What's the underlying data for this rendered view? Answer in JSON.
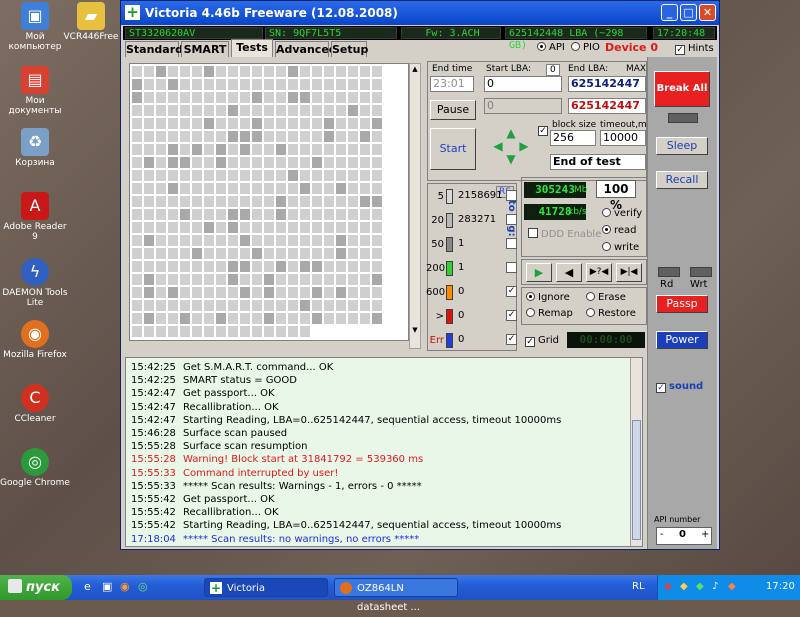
{
  "window": {
    "title": "Victoria 4.46b Freeware (12.08.2008)",
    "min": "_",
    "max": "□",
    "close": "✕"
  },
  "infobar": {
    "model": "ST3320620AV",
    "serial": "SN: 9QF7L5T5",
    "firmware": "Fw: 3.ACH",
    "lba": "625142448 LBA (~298 GB)",
    "time": "17:20:48"
  },
  "tabs": [
    "Standard",
    "SMART",
    "Tests",
    "Advanced",
    "Setup"
  ],
  "mode": {
    "api": "API",
    "pio": "PIO",
    "device": "Device 0",
    "hints": "Hints"
  },
  "controls": {
    "end_time_label": "End time",
    "end_time_value": "23:01",
    "start_lba_label": "Start LBA:",
    "start_lba_zero": "0",
    "start_lba_value": "0",
    "end_lba_label": "End LBA:",
    "end_lba_max": "MAX",
    "end_lba_value": "625142447",
    "end_lba_current": "625142447",
    "second_value": "0",
    "pause": "Pause",
    "start": "Start",
    "block_size_label": "block size",
    "block_size_value": "256",
    "timeout_label": "timeout,ms",
    "timeout_value": "10000",
    "end_action": "End of test"
  },
  "stats": {
    "rs": "RS",
    "to_log": "to log:",
    "rows": [
      {
        "label": "5",
        "value": "2158691",
        "color": "#d8d8d8"
      },
      {
        "label": "20",
        "value": "283271",
        "color": "#b8b8b8"
      },
      {
        "label": "50",
        "value": "1",
        "color": "#888888"
      },
      {
        "label": "200",
        "value": "1",
        "color": "#30d030"
      },
      {
        "label": "600",
        "value": "0",
        "color": "#ff8a00"
      },
      {
        "label": ">",
        "value": "0",
        "color": "#e01010"
      },
      {
        "label": "Err",
        "value": "0",
        "color": "#1f3fd8"
      }
    ]
  },
  "speed": {
    "mb": "305243",
    "mb_unit": "Mb",
    "percent": "100",
    "percent_unit": "%",
    "kbs": "41728",
    "kbs_unit": "kb/s",
    "ddd": "DDD Enable",
    "verify": "verify",
    "read": "read",
    "write": "write"
  },
  "actions": {
    "ignore": "Ignore",
    "erase": "Erase",
    "remap": "Remap",
    "restore": "Restore",
    "grid": "Grid",
    "timer": "00:00:00"
  },
  "right": {
    "break_all": "Break All",
    "sleep": "Sleep",
    "recall": "Recall",
    "rd": "Rd",
    "wrt": "Wrt",
    "passp": "Passp",
    "power": "Power",
    "sound": "sound",
    "api_number_label": "API number",
    "api_number_value": "0",
    "minus": "-",
    "plus": "+"
  },
  "log": [
    {
      "time": "15:42:25",
      "text": "Get S.M.A.R.T. command... OK",
      "color": "#000000"
    },
    {
      "time": "15:42:25",
      "text": "SMART status = GOOD",
      "color": "#000000"
    },
    {
      "time": "15:42:47",
      "text": "Get passport... OK",
      "color": "#000000"
    },
    {
      "time": "15:42:47",
      "text": "Recallibration... OK",
      "color": "#000000"
    },
    {
      "time": "15:42:47",
      "text": "Starting Reading, LBA=0..625142447, sequential access, timeout 10000ms",
      "color": "#000000"
    },
    {
      "time": "15:46:28",
      "text": "Surface scan paused",
      "color": "#000000"
    },
    {
      "time": "15:55:28",
      "text": "Surface scan resumption",
      "color": "#000000"
    },
    {
      "time": "15:55:28",
      "text": "Warning! Block start at 31841792 = 539360 ms",
      "color": "#e01818"
    },
    {
      "time": "15:55:33",
      "text": "Command interrupted by user!",
      "color": "#e01818"
    },
    {
      "time": "15:55:33",
      "text": "***** Scan results: Warnings - 1, errors - 0 *****",
      "color": "#000000"
    },
    {
      "time": "15:55:42",
      "text": "Get passport... OK",
      "color": "#000000"
    },
    {
      "time": "15:55:42",
      "text": "Recallibration... OK",
      "color": "#000000"
    },
    {
      "time": "15:55:42",
      "text": "Starting Reading, LBA=0..625142447, sequential access, timeout 10000ms",
      "color": "#000000"
    },
    {
      "time": "17:18:04",
      "text": "***** Scan results: no warnings, no errors *****",
      "color": "#1a2ee0"
    }
  ],
  "desktop": [
    {
      "label": "Мой компьютер",
      "icon": "computer-icon",
      "color": "#3f7fd8"
    },
    {
      "label": "VCR446Free",
      "icon": "folder-icon",
      "color": "#e8c040"
    },
    {
      "label": "Мои документы",
      "icon": "documents-icon",
      "color": "#d84030"
    },
    {
      "label": "Корзина",
      "icon": "recycle-bin-icon",
      "color": "#7aa0c8"
    },
    {
      "label": "Adobe Reader 9",
      "icon": "adobe-reader-icon",
      "color": "#c81818"
    },
    {
      "label": "DAEMON Tools Lite",
      "icon": "daemon-tools-icon",
      "color": "#3060c0"
    },
    {
      "label": "Mozilla Firefox",
      "icon": "firefox-icon",
      "color": "#e07020"
    },
    {
      "label": "CCleaner",
      "icon": "ccleaner-icon",
      "color": "#d03020"
    },
    {
      "label": "Google Chrome",
      "icon": "chrome-icon",
      "color": "#2a9a3a"
    }
  ],
  "taskbar": {
    "start": "пуск",
    "task1": "Victoria",
    "task2": "OZ864LN datasheet ...",
    "lang": "RL",
    "clock": "17:20"
  }
}
